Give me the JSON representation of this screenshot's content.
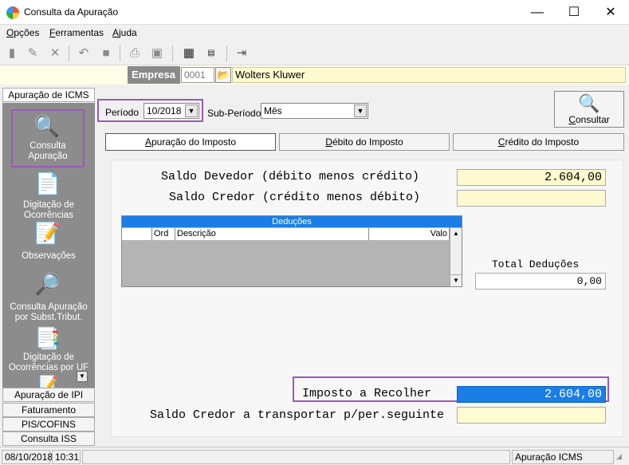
{
  "window": {
    "title": "Consulta da Apuração",
    "minimize": "—",
    "maximize": "☐",
    "close": "✕"
  },
  "menu": [
    {
      "label": "Opções",
      "u": "O",
      "rest": "pções"
    },
    {
      "label": "Ferramentas",
      "u": "F",
      "rest": "erramentas"
    },
    {
      "label": "Ajuda",
      "u": "A",
      "rest": "juda"
    }
  ],
  "empresa": {
    "label": "Empresa",
    "code": "0001",
    "name": "Wolters Kluwer"
  },
  "sidebar": {
    "top_tab": "Apuração de ICMS",
    "items": [
      {
        "label1": "Consulta",
        "label2": "Apuração"
      },
      {
        "label1": "Digitação de",
        "label2": "Ocorrências"
      },
      {
        "label1": "Observações",
        "label2": ""
      },
      {
        "label1": "Consulta Apuração",
        "label2": "por Subst.Tribut."
      },
      {
        "label1": "Digitação de",
        "label2": "Ocorrências por UF"
      }
    ],
    "bottom_tabs": [
      "Apuração de IPI",
      "Faturamento",
      "PIS/COFINS",
      "Consulta ISS"
    ]
  },
  "filters": {
    "periodo_label": "Período",
    "periodo_value": "10/2018",
    "subperiodo_label": "Sub-Período",
    "subperiodo_value": "Mês"
  },
  "consultar": {
    "label": "Consultar",
    "u": "C",
    "rest": "onsultar"
  },
  "tabs": [
    {
      "label": "Apuração do Imposto",
      "u": "A",
      "rest": "puração do Imposto"
    },
    {
      "label": "Débito do Imposto",
      "u": "D",
      "rest": "ébito do Imposto"
    },
    {
      "label": "Crédito do Imposto",
      "u": "C",
      "rest": "rédito do Imposto"
    }
  ],
  "fields": {
    "saldo_devedor_label": "Saldo Devedor (débito menos crédito)",
    "saldo_devedor_value": "2.604,00",
    "saldo_credor_label": "Saldo Credor (crédito menos débito)",
    "saldo_credor_value": "",
    "total_deducoes_label": "Total Deduções",
    "total_deducoes_value": "0,00",
    "imposto_label": "Imposto a Recolher",
    "imposto_value": "2.604,00",
    "saldo_transportar_label": "Saldo Credor a transportar p/per.seguinte",
    "saldo_transportar_value": ""
  },
  "deducoes_grid": {
    "caption": "Deduções",
    "columns": [
      "",
      "Ord",
      "Descrição",
      "Valo"
    ]
  },
  "status": {
    "date": "08/10/2018",
    "time": "10:31",
    "module": "Apuração ICMS"
  },
  "colors": {
    "highlight": "#9b59b6",
    "selection_blue": "#1a7ee6",
    "field_yellow": "#fffbd0"
  }
}
